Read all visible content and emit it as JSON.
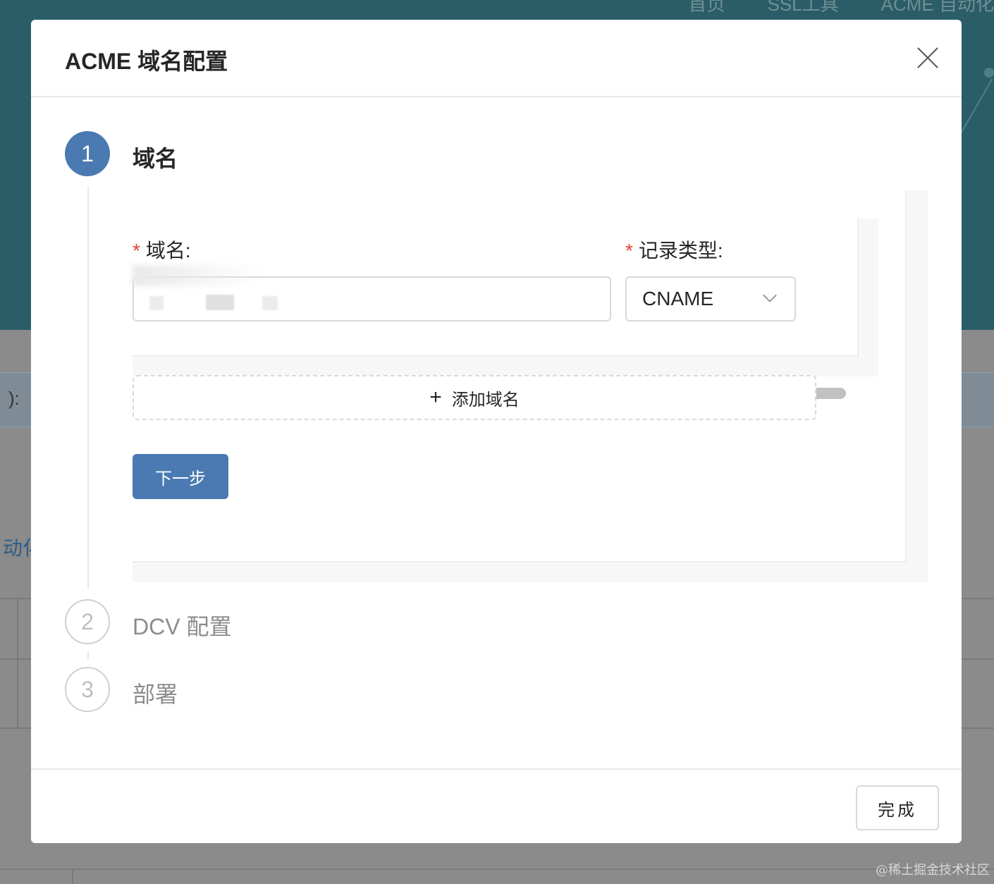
{
  "background": {
    "nav_items": [
      "首页",
      "SSL工具",
      "ACME 自动化"
    ],
    "band_text": "):",
    "link_text": "动化",
    "watermark": "@稀土掘金技术社区"
  },
  "modal": {
    "title": "ACME 域名配置",
    "close_icon": "close-icon",
    "steps": [
      {
        "number": "1",
        "title": "域名",
        "status": "active"
      },
      {
        "number": "2",
        "title": "DCV 配置",
        "status": "wait"
      },
      {
        "number": "3",
        "title": "部署",
        "status": "wait"
      }
    ],
    "form": {
      "domain_label": "域名:",
      "domain_value": "",
      "record_type_label": "记录类型:",
      "record_type_value": "CNAME",
      "required_mark": "*",
      "add_domain_label": "添加域名",
      "next_label": "下一步"
    },
    "footer": {
      "done_label": "完成"
    },
    "colors": {
      "primary": "#4a7ab1",
      "required": "#e0413a",
      "header_bg": "#2b5d68"
    }
  }
}
